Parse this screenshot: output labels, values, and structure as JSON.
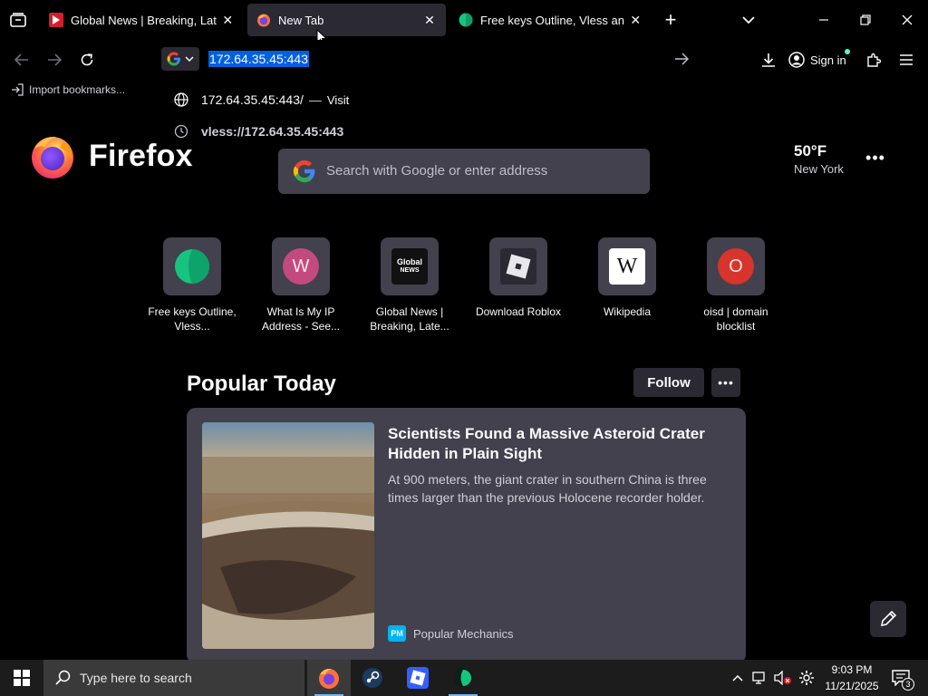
{
  "tabs": [
    {
      "title": "Global News | Breaking, Latest N",
      "favicon": "global-news-icon",
      "selected": false
    },
    {
      "title": "New Tab",
      "favicon": "firefox-icon",
      "selected": true
    },
    {
      "title": "Free keys Outline, Vless and Tro",
      "favicon": "green-leaf-icon",
      "selected": false
    }
  ],
  "toolbar": {
    "url_value": "172.64.35.45:443",
    "signin_label": "Sign in"
  },
  "dropdown": {
    "rows": [
      {
        "text": "172.64.35.45:443/",
        "separator": "—",
        "action": "Visit",
        "icon": "globe-icon"
      },
      {
        "text": "vless://172.64.35.45:443",
        "icon": "history-clock-icon"
      }
    ]
  },
  "bookmarks_bar": {
    "import_label": "Import bookmarks..."
  },
  "newtab": {
    "brand": "Firefox",
    "search_placeholder": "Search with Google or enter address",
    "weather": {
      "temp": "50°F",
      "location": "New York"
    },
    "shortcuts": [
      {
        "label": "Free keys Outline, Vless...",
        "icon": "green-leaf-icon"
      },
      {
        "label": "What Is My IP Address - See...",
        "icon": "letter-w-icon",
        "letter": "W",
        "color": "#c24a7f"
      },
      {
        "label": "Global News | Breaking, Late...",
        "icon": "global-news-icon"
      },
      {
        "label": "Download Roblox",
        "icon": "roblox-icon"
      },
      {
        "label": "Wikipedia",
        "icon": "wikipedia-icon",
        "letter": "W"
      },
      {
        "label": "oisd | domain blocklist",
        "icon": "letter-o-icon",
        "letter": "O",
        "color": "#d6342c"
      }
    ],
    "popular": {
      "heading": "Popular Today",
      "follow_label": "Follow",
      "card": {
        "title": "Scientists Found a Massive Asteroid Crater Hidden in Plain Sight",
        "description": "At 900 meters, the giant crater in southern China is three times larger than the previous Holocene recorder holder.",
        "source": "Popular Mechanics",
        "source_badge": "PM"
      }
    }
  },
  "taskbar": {
    "search_placeholder": "Type here to search",
    "time": "9:03 PM",
    "date": "11/21/2025",
    "notification_count": "3"
  },
  "colors": {
    "accent": "#0060df",
    "panel": "#42414d",
    "selected_tab": "#2b2a33",
    "taskbar": "#1c1c1c"
  }
}
